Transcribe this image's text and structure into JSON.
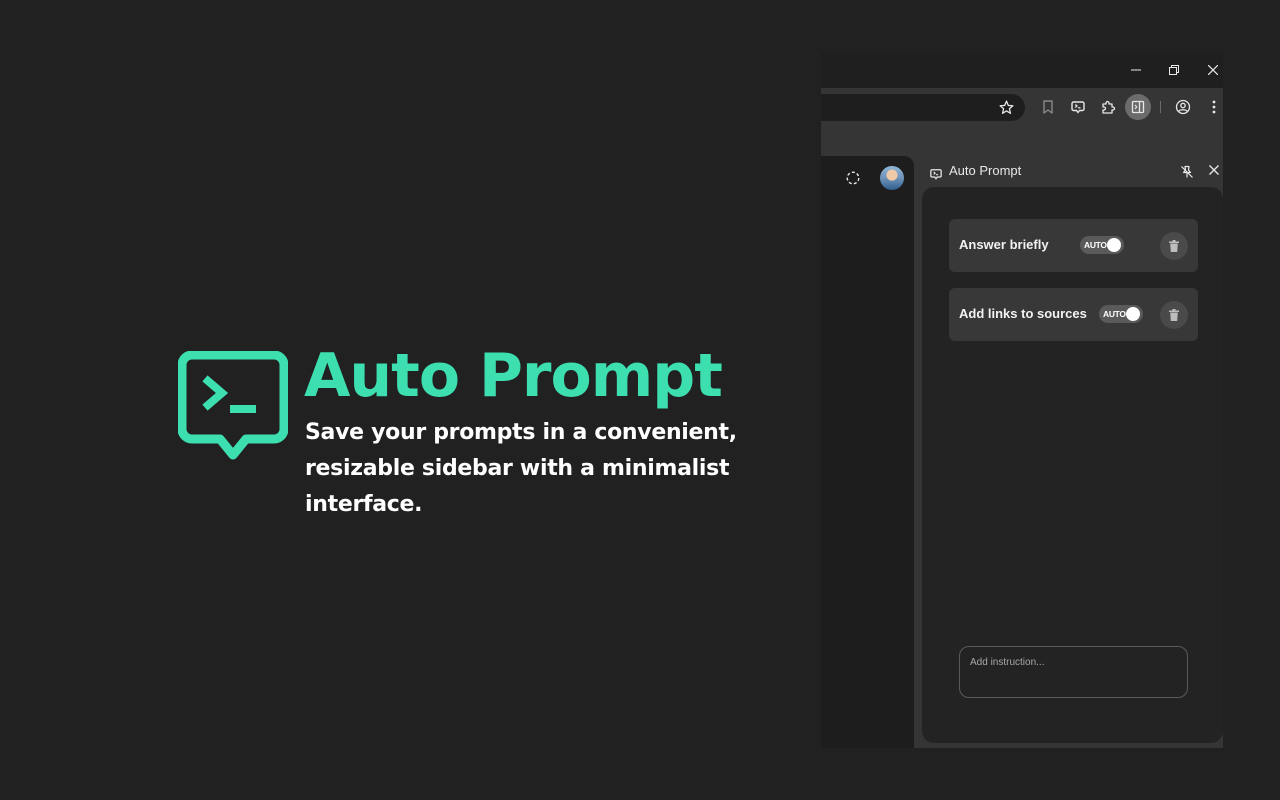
{
  "hero": {
    "logo_icon": "terminal-chat-bubble-icon",
    "title": "Auto Prompt",
    "subtitle": "Save your prompts in a convenient, resizable sidebar with a minimalist interface.",
    "accent_color": "#3ddfb0"
  },
  "browser": {
    "window_controls": {
      "minimize_icon": "minimize-icon",
      "restore_icon": "restore-icon",
      "close_icon": "close-icon"
    },
    "toolbar": {
      "bookmark_star_icon": "star-icon",
      "icons": [
        "bookmark-icon",
        "auto-prompt-extension-icon",
        "puzzle-extensions-icon",
        "side-panel-icon",
        "profile-icon",
        "more-menu-icon"
      ]
    },
    "page": {
      "loader_icon": "loading-circle-icon",
      "avatar_icon": "user-avatar"
    },
    "side_panel": {
      "title": "Auto Prompt",
      "header_icon": "auto-prompt-icon",
      "pin_icon": "unpin-icon",
      "close_icon": "close-icon",
      "prompts": [
        {
          "label": "Answer briefly",
          "toggle_label": "AUTO",
          "toggle_on": true
        },
        {
          "label": "Add links to sources",
          "toggle_label": "AUTO",
          "toggle_on": true
        }
      ],
      "delete_icon": "trash-icon",
      "input": {
        "placeholder": "Add instruction...",
        "value": ""
      }
    }
  }
}
